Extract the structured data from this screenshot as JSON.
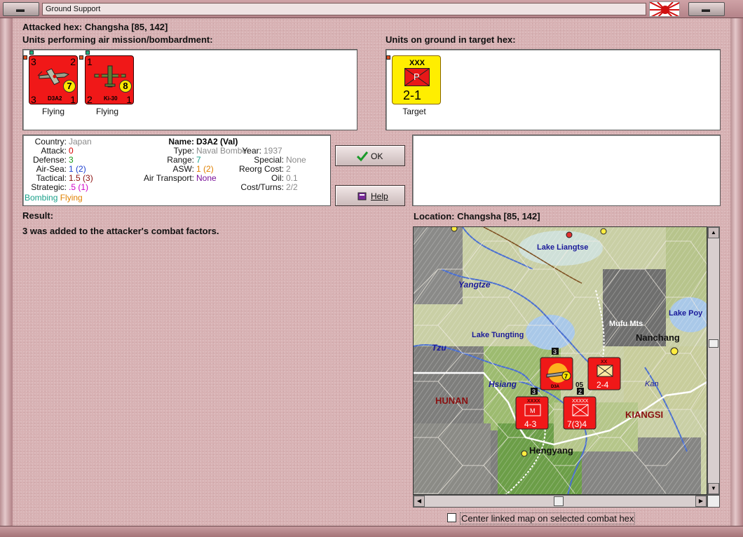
{
  "window": {
    "title": "Ground Support",
    "min_button": "▬",
    "close_button": "▬"
  },
  "attacked_hex": "Attacked hex: Changsha  [85, 142]",
  "attackers": {
    "heading": "Units performing air mission/bombardment:",
    "units": [
      {
        "name": "D3A2",
        "status": "Flying",
        "top_left": "3",
        "top_right": "2",
        "bottom_left": "3",
        "bottom_right": "1",
        "range": "7"
      },
      {
        "name": "Ki-30",
        "status": "Flying",
        "top_left": "1",
        "top_right": "",
        "bottom_left": "2",
        "bottom_right": "1",
        "range": "8"
      }
    ]
  },
  "defenders": {
    "heading": "Units on ground in target hex:",
    "units": [
      {
        "size": "XXX",
        "type": "P",
        "strength": "2-1",
        "status": "Target"
      }
    ]
  },
  "unit_info": {
    "country_key": "Country:",
    "country_val": "Japan",
    "attack_key": "Attack:",
    "attack_val": "0",
    "defense_key": "Defense:",
    "defense_val": "3",
    "airsea_key": "Air-Sea:",
    "airsea_val": "1",
    "airsea_extra": "(2)",
    "tactical_key": "Tactical:",
    "tactical_val": "1.5",
    "tactical_extra": "(3)",
    "strategic_key": "Strategic:",
    "strategic_val": ".5",
    "strategic_extra": "(1)",
    "mission_a": "Bombing",
    "mission_b": "Flying",
    "name_key": "Name:",
    "name_val": "D3A2 (Val)",
    "type_key": "Type:",
    "type_val": "Naval Bomber",
    "year_key": "Year:",
    "year_val": "1937",
    "range_key": "Range:",
    "range_val": "7",
    "special_key": "Special:",
    "special_val": "None",
    "asw_key": "ASW:",
    "asw_val": "1",
    "asw_extra": "(2)",
    "reorg_key": "Reorg Cost:",
    "reorg_val": "2",
    "airtrans_key": "Air Transport:",
    "airtrans_val": "None",
    "oil_key": "Oil:",
    "oil_val": "0.1",
    "costturns_key": "Cost/Turns:",
    "costturns_val": "2/2"
  },
  "buttons": {
    "ok": "OK",
    "help": "Help"
  },
  "result": {
    "heading": "Result:",
    "text": "3 was added to the attacker's combat factors."
  },
  "location": {
    "heading": "Location:  Changsha  [85, 142]"
  },
  "map": {
    "labels": {
      "lake_liangtse": "Lake Liangtse",
      "yangtze": "Yangtze",
      "lake_po": "Lake Poy",
      "mufu": "Mufu Mts",
      "nanchang": "Nanchang",
      "lake_tungting": "Lake Tungting",
      "tzu": "Tzu",
      "hsiang": "Hsiang",
      "kan": "Kan",
      "hunan": "HUNAN",
      "kiangsi": "KIANGSI",
      "hengyang": "Hengyang",
      "stack_count_a": "3",
      "stack_count_b": "3",
      "stack_count_c": "2",
      "stack_count_d": "05"
    },
    "counters": [
      {
        "id": "map-counter-air",
        "value": "7",
        "sub": "D3A"
      },
      {
        "id": "map-counter-xx",
        "size": "XX",
        "strength": "2-4"
      },
      {
        "id": "map-counter-xxxx",
        "size": "XXXX",
        "type": "M",
        "strength": "4-3"
      },
      {
        "id": "map-counter-xxxxx",
        "size": "XXXXX",
        "strength": "7(3)4"
      }
    ]
  },
  "center_linked": {
    "label": "Center linked map on selected combat hex",
    "checked": false
  }
}
